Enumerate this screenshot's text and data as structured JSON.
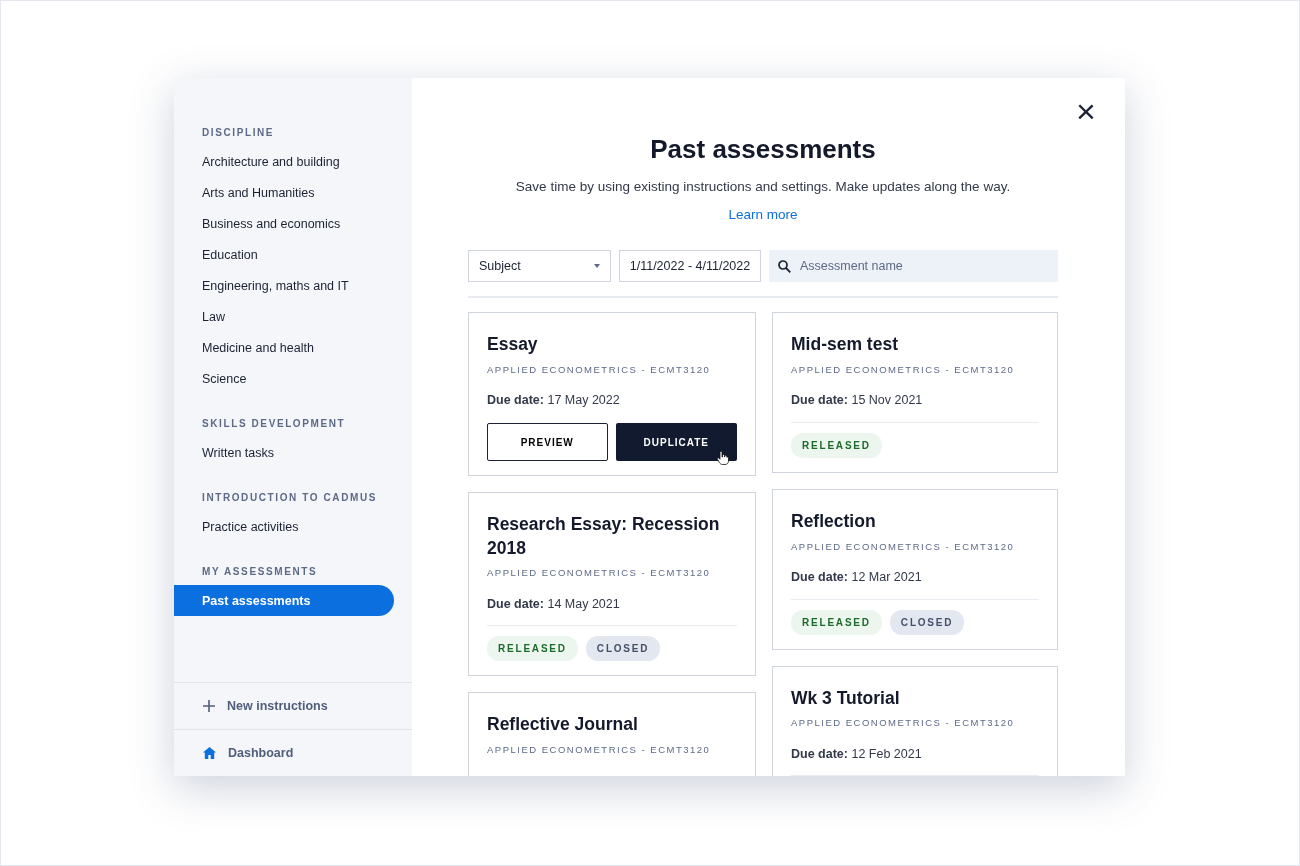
{
  "sidebar": {
    "sections": [
      {
        "heading": "DISCIPLINE",
        "items": [
          {
            "label": "Architecture and building",
            "selected": false
          },
          {
            "label": "Arts and Humanities",
            "selected": false
          },
          {
            "label": "Business and economics",
            "selected": false
          },
          {
            "label": "Education",
            "selected": false
          },
          {
            "label": "Engineering, maths and IT",
            "selected": false
          },
          {
            "label": "Law",
            "selected": false
          },
          {
            "label": "Medicine and health",
            "selected": false
          },
          {
            "label": "Science",
            "selected": false
          }
        ]
      },
      {
        "heading": "SKILLS DEVELOPMENT",
        "items": [
          {
            "label": "Written tasks",
            "selected": false
          }
        ]
      },
      {
        "heading": "INTRODUCTION TO CADMUS",
        "items": [
          {
            "label": "Practice activities",
            "selected": false
          }
        ]
      },
      {
        "heading": "MY ASSESSMENTS",
        "items": [
          {
            "label": "Past assessments",
            "selected": true
          }
        ]
      }
    ],
    "footer": [
      {
        "label": "New instructions",
        "kind": "plus"
      },
      {
        "label": "Dashboard",
        "kind": "home"
      }
    ]
  },
  "close": "×",
  "title": "Past assessments",
  "subtitle": "Save time by using existing instructions and settings. Make updates along the way.",
  "learn_more": "Learn more",
  "filters": {
    "subject": "Subject",
    "date_range": "1/11/2022 - 4/11/2022",
    "search_placeholder": "Assessment name"
  },
  "card_columns": [
    {
      "cards": [
        {
          "title": "Essay",
          "course": "APPLIED ECONOMETRICS - ECMT3120",
          "due_label": "Due date:",
          "due": "17 May 2022",
          "kind": "actions",
          "buttons": [
            "PREVIEW",
            "DUPLICATE"
          ]
        },
        {
          "title": "Research Essay: Recession 2018",
          "course": "APPLIED ECONOMETRICS - ECMT3120",
          "due_label": "Due date:",
          "due": "14 May 2021",
          "kind": "tags",
          "tags": [
            {
              "label": "RELEASED",
              "kind": "released"
            },
            {
              "label": "CLOSED",
              "kind": "closed"
            }
          ]
        },
        {
          "title": "Reflective Journal",
          "course": "APPLIED ECONOMETRICS - ECMT3120",
          "kind": "tags"
        }
      ]
    },
    {
      "cards": [
        {
          "title": "Mid-sem test",
          "course": "APPLIED ECONOMETRICS - ECMT3120",
          "due_label": "Due date:",
          "due": "15 Nov 2021",
          "kind": "tags",
          "tags": [
            {
              "label": "RELEASED",
              "kind": "released"
            }
          ]
        },
        {
          "title": "Reflection",
          "course": "APPLIED ECONOMETRICS - ECMT3120",
          "due_label": "Due date:",
          "due": "12 Mar 2021",
          "kind": "tags",
          "tags": [
            {
              "label": "RELEASED",
              "kind": "released"
            },
            {
              "label": "CLOSED",
              "kind": "closed"
            }
          ]
        },
        {
          "title": "Wk 3 Tutorial",
          "course": "APPLIED ECONOMETRICS - ECMT3120",
          "due_label": "Due date:",
          "due": "12 Feb 2021",
          "kind": "tags"
        }
      ]
    }
  ]
}
